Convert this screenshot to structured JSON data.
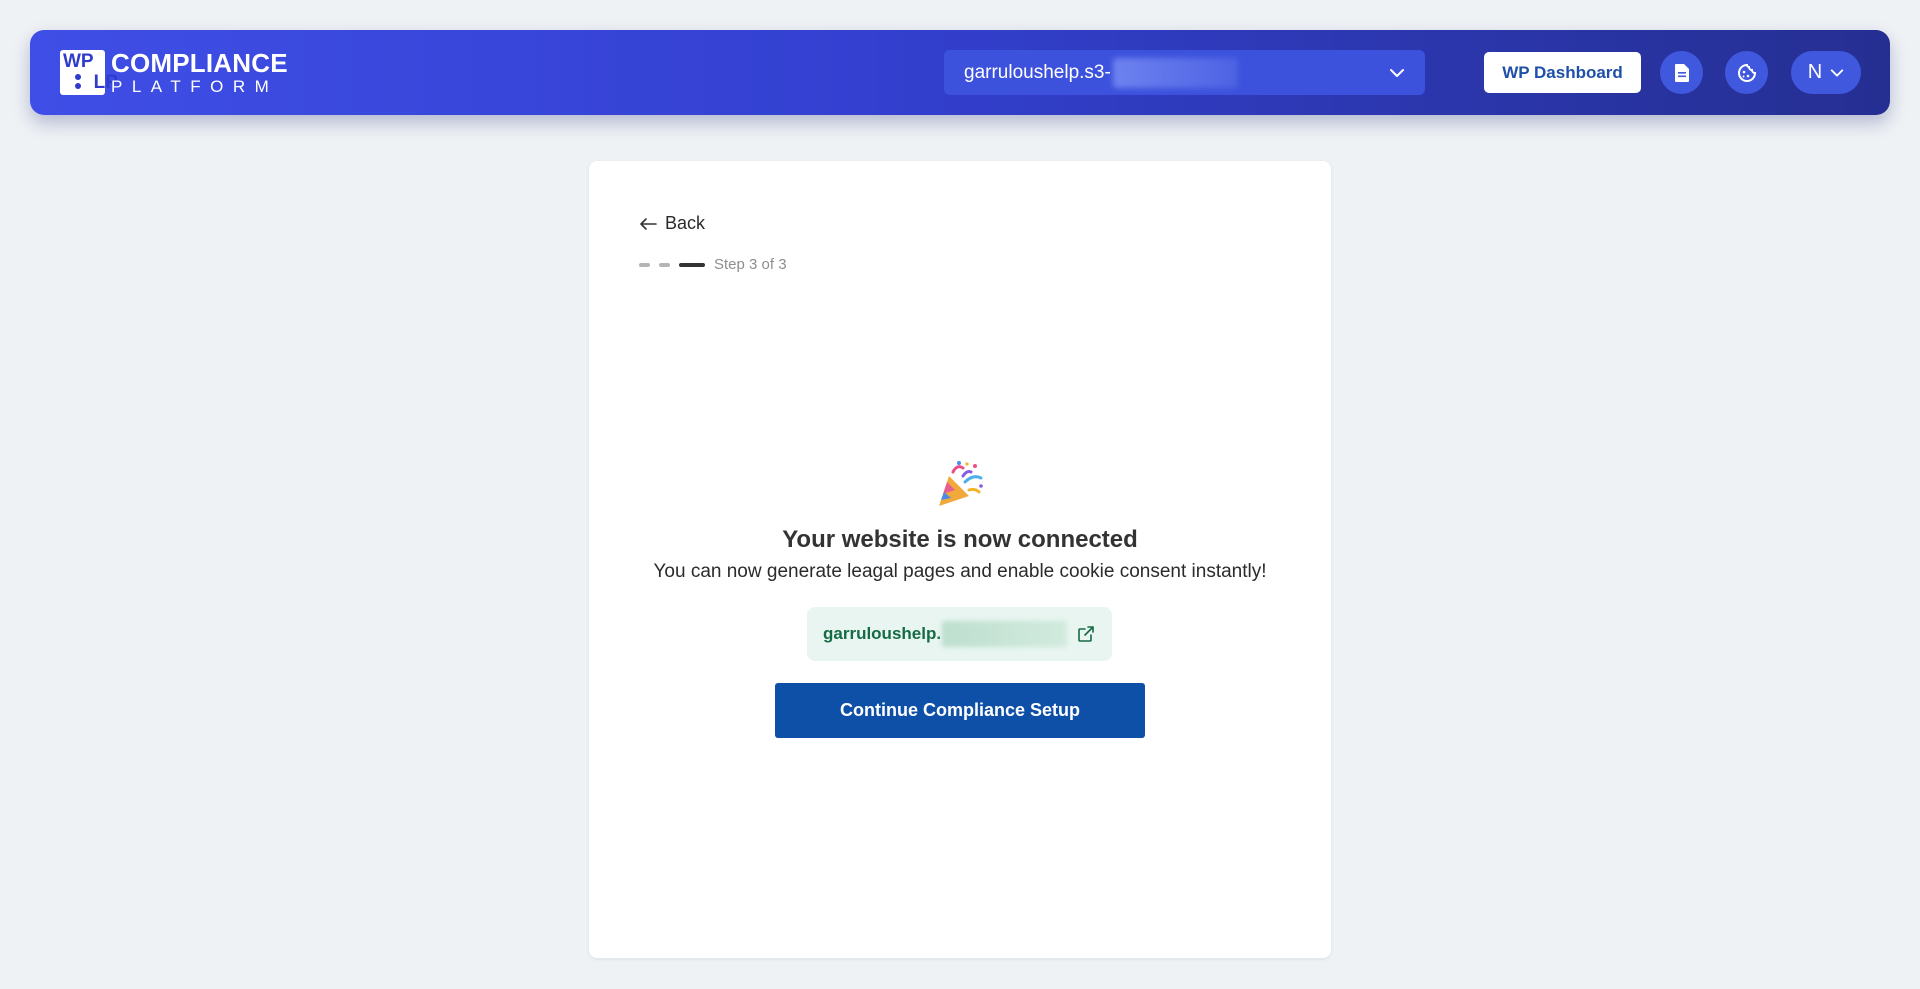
{
  "header": {
    "logo": {
      "mark": [
        "WP",
        "",
        "LP"
      ],
      "title_line1": "COMPLIANCE",
      "title_line2": "PLATFORM"
    },
    "site_selector": {
      "value_visible": "garruloushelp.s3-",
      "icon": "chevron-down-icon"
    },
    "wp_dashboard_label": "WP Dashboard",
    "icons": [
      "document-icon",
      "cookie-icon"
    ],
    "user": {
      "initial": "N",
      "icon": "chevron-down-icon"
    }
  },
  "card": {
    "back_label": "Back",
    "step": {
      "label": "Step 3 of 3",
      "current": 3,
      "total": 3
    },
    "emoji": "party-popper-icon",
    "headline": "Your website is now connected",
    "subtext": "You can now generate leagal pages and enable cookie consent instantly!",
    "site_url_visible": "garruloushelp.",
    "continue_label": "Continue Compliance Setup"
  },
  "colors": {
    "navbar_gradient_start": "#3f4ee6",
    "navbar_gradient_end": "#252f92",
    "primary_button": "#0e4fa8",
    "url_chip_bg": "#e8f5f0",
    "url_chip_text": "#156b45",
    "page_bg": "#eff2f5"
  }
}
